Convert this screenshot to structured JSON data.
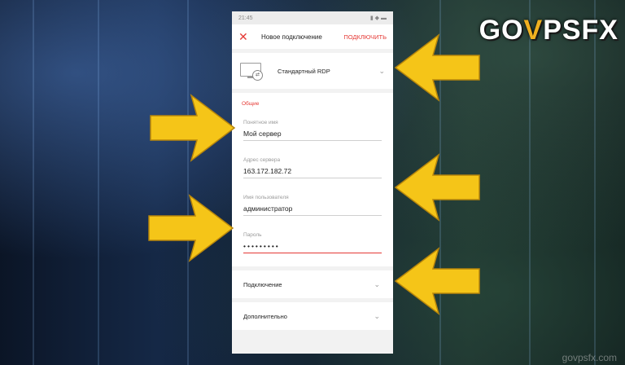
{
  "watermark": {
    "logo_left": "GO",
    "logo_accent": "V",
    "logo_right": "PSFX",
    "footer": "govpsfx.com"
  },
  "status_bar": {
    "time": "21:45",
    "icons": "▮ ◆ ▬"
  },
  "topbar": {
    "close_glyph": "✕",
    "title": "Новое подключение",
    "action": "ПОДКЛЮЧИТЬ"
  },
  "connection_type": {
    "label": "Стандартный RDP",
    "icon": "monitor-rdp-icon"
  },
  "form": {
    "section_title": "Общие",
    "fields": [
      {
        "label": "Понятное имя",
        "value": "Мой сервер"
      },
      {
        "label": "Адрес сервера",
        "value": "163.172.182.72"
      },
      {
        "label": "Имя пользователя",
        "value": "администратор"
      },
      {
        "label": "Пароль",
        "value": "•••••••••"
      }
    ]
  },
  "sections": [
    {
      "label": "Подключение"
    },
    {
      "label": "Дополнительно"
    }
  ],
  "colors": {
    "accent": "#e53935",
    "arrow": "#f5c518"
  }
}
